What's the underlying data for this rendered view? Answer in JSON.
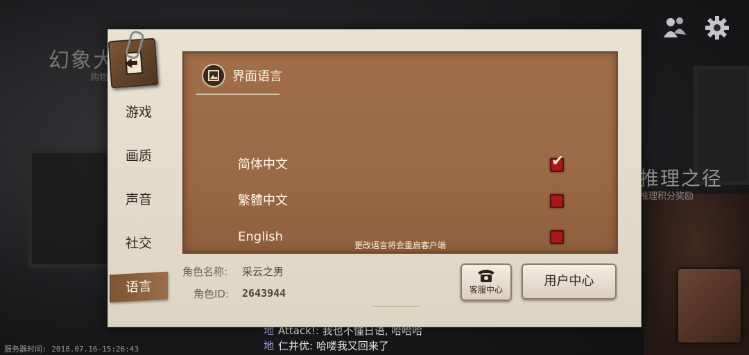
{
  "background": {
    "left_title": "幻象大",
    "left_sub": "购物",
    "right_title": "推理之径",
    "right_sub": "推理积分奖励",
    "chat": [
      {
        "tag": "地",
        "text": "Attack!: 我也不懂日语, 哈哈哈"
      },
      {
        "tag": "地",
        "text": "仁井优: 哈喽我又回来了"
      }
    ],
    "server_time": "服务器时间:   2018.07.16-15:26:43"
  },
  "top_icons": [
    "friends-icon",
    "gear-icon"
  ],
  "sidebar": {
    "items": [
      {
        "label": "游戏",
        "active": false
      },
      {
        "label": "画质",
        "active": false
      },
      {
        "label": "声音",
        "active": false
      },
      {
        "label": "社交",
        "active": false
      },
      {
        "label": "语言",
        "active": true
      }
    ]
  },
  "language": {
    "section_title": "界面语言",
    "options": [
      {
        "label": "简体中文",
        "checked": true
      },
      {
        "label": "繁體中文",
        "checked": false
      },
      {
        "label": "English",
        "checked": false
      }
    ],
    "restart_note": "更改语言将会重启客户端"
  },
  "account": {
    "name_label": "角色名称:",
    "name_value": "采云之男",
    "id_label": "角色ID:",
    "id_value": "2643944"
  },
  "buttons": {
    "support": "客服中心",
    "user_center": "用户中心"
  },
  "colors": {
    "content_brown": "#9b6945",
    "checkbox_red": "#a8181a",
    "active_tab": "#8a603f"
  }
}
